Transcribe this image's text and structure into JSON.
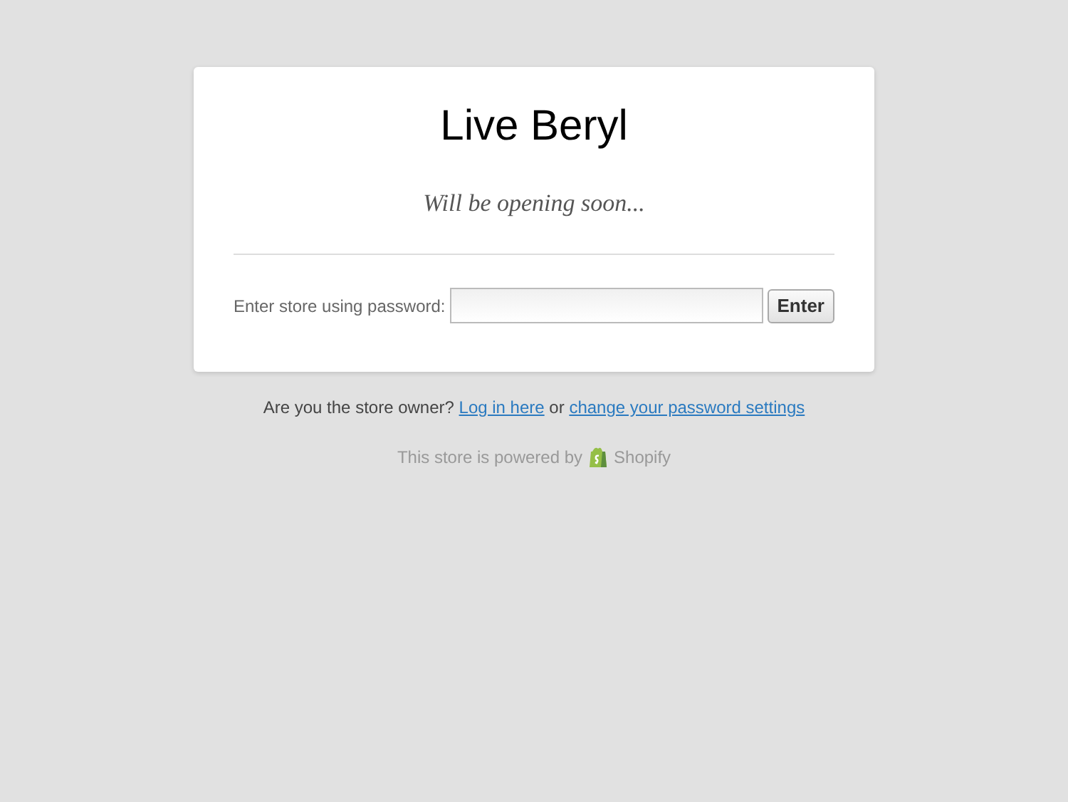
{
  "card": {
    "title": "Live Beryl",
    "subtitle": "Will be opening soon...",
    "password_label": "Enter store using password:",
    "enter_button": "Enter"
  },
  "owner_prompt": {
    "question": "Are you the store owner?",
    "login_link": "Log in here",
    "joiner": "or",
    "settings_link": "change your password settings"
  },
  "powered_by": {
    "text": "This store is powered by",
    "brand": "Shopify"
  }
}
